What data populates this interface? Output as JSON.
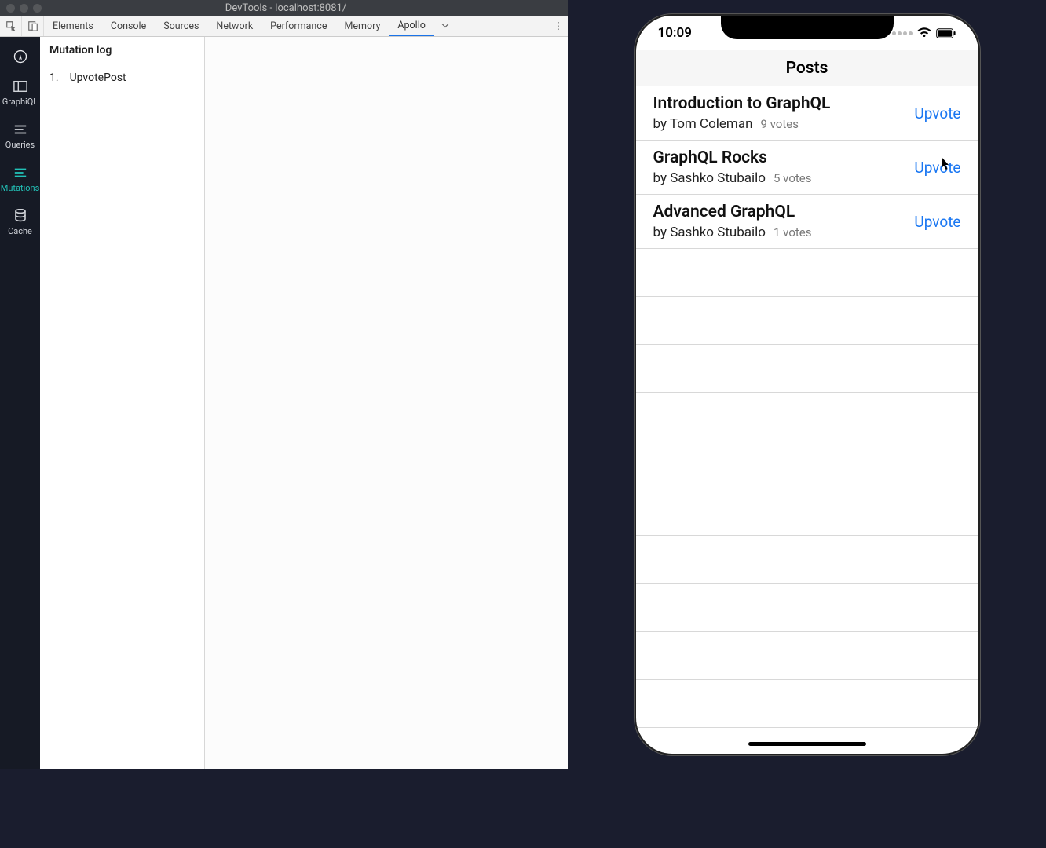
{
  "devtools": {
    "title": "DevTools - localhost:8081/",
    "tabs": [
      "Elements",
      "Console",
      "Sources",
      "Network",
      "Performance",
      "Memory",
      "Apollo"
    ],
    "active_tab": "Apollo"
  },
  "apollo": {
    "sidebar": [
      {
        "id": "logo",
        "label": ""
      },
      {
        "id": "graphiql",
        "label": "GraphiQL"
      },
      {
        "id": "queries",
        "label": "Queries"
      },
      {
        "id": "mutations",
        "label": "Mutations"
      },
      {
        "id": "cache",
        "label": "Cache"
      }
    ],
    "active_sidebar": "mutations",
    "panel_header": "Mutation log",
    "mutations": [
      {
        "index": "1.",
        "name": "UpvotePost"
      }
    ]
  },
  "phone": {
    "time": "10:09",
    "nav_title": "Posts",
    "upvote_label": "Upvote",
    "posts": [
      {
        "title": "Introduction to GraphQL",
        "author": "by Tom Coleman",
        "votes": "9 votes"
      },
      {
        "title": "GraphQL Rocks",
        "author": "by Sashko Stubailo",
        "votes": "5 votes"
      },
      {
        "title": "Advanced GraphQL",
        "author": "by Sashko Stubailo",
        "votes": "1 votes"
      }
    ],
    "empty_row_count": 11
  }
}
